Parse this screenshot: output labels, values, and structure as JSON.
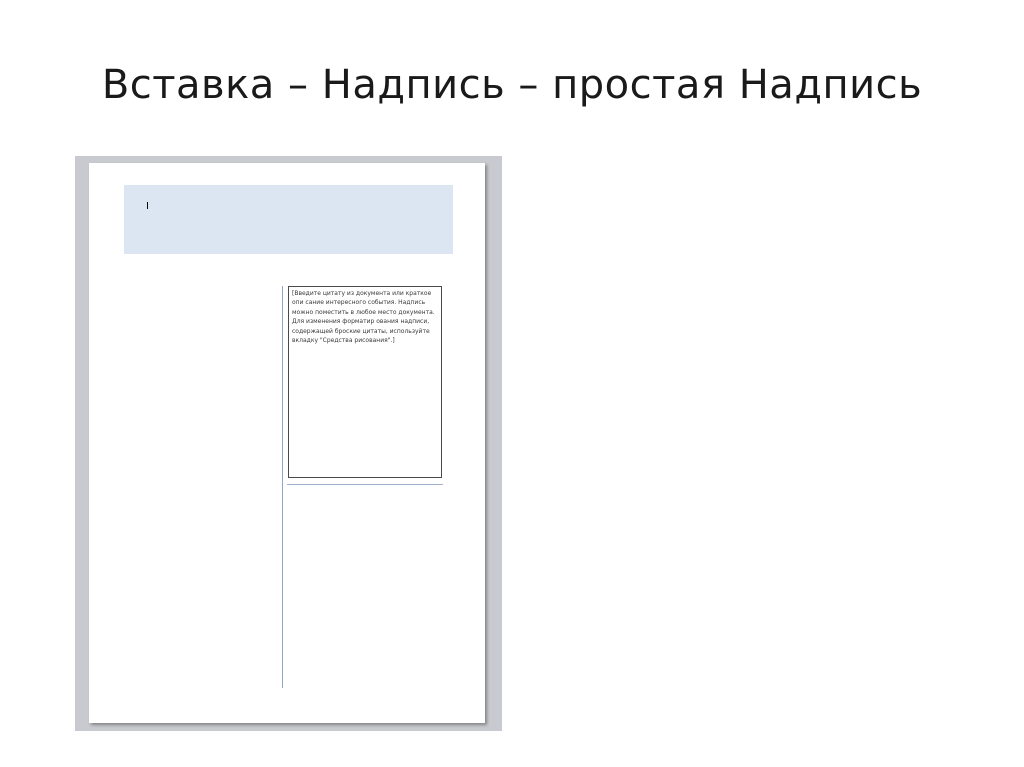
{
  "slide": {
    "title": "Вставка – Надпись – простая Надпись"
  },
  "document": {
    "header_cursor": "I",
    "quote_text": "[Введите цитату из документа или краткое опи сание интересного события. Надпись можно поместить в любое место документа. Для изменения форматир ования надписи, содержащей броские цитаты, используйте вкладку \"Средства рисования\".]"
  },
  "colors": {
    "header_fill": "#dce6f2",
    "frame_gray": "#c8cacf",
    "rule_blue": "#8fa6c4"
  }
}
